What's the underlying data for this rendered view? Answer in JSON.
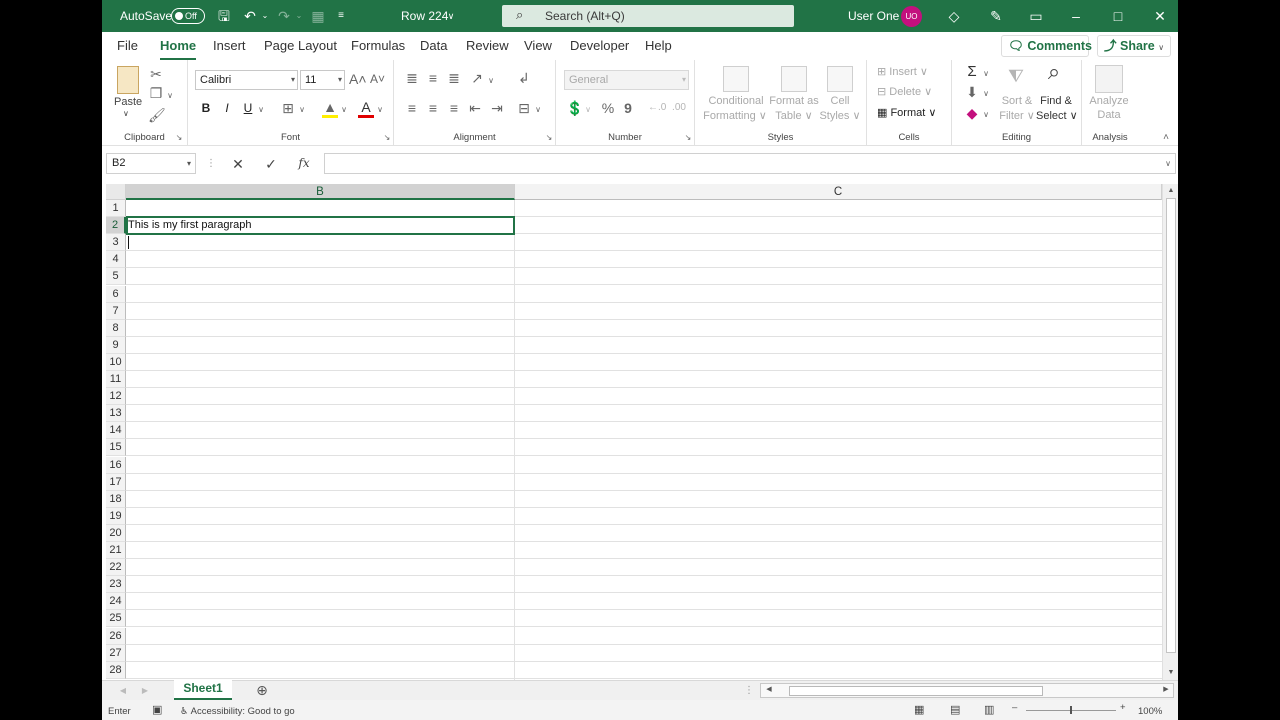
{
  "titlebar": {
    "autosave_label": "AutoSave",
    "autosave_state": "Off",
    "document_title": "Row 224",
    "search_placeholder": "Search (Alt+Q)",
    "user_name": "User One",
    "user_initials": "UO"
  },
  "tabs": [
    "File",
    "Home",
    "Insert",
    "Page Layout",
    "Formulas",
    "Data",
    "Review",
    "View",
    "Developer",
    "Help"
  ],
  "active_tab": "Home",
  "comments_label": "Comments",
  "share_label": "Share",
  "ribbon": {
    "clipboard": {
      "paste": "Paste",
      "label": "Clipboard"
    },
    "font": {
      "family": "Calibri",
      "size": "11",
      "bold": "B",
      "italic": "I",
      "underline": "U",
      "label": "Font"
    },
    "alignment": {
      "label": "Alignment"
    },
    "number": {
      "format": "General",
      "percent": "%",
      "comma": "9",
      "label": "Number"
    },
    "styles": {
      "conditional_1": "Conditional",
      "conditional_2": "Formatting",
      "format_table_1": "Format as",
      "format_table_2": "Table",
      "cell_styles_1": "Cell",
      "cell_styles_2": "Styles",
      "label": "Styles"
    },
    "cells": {
      "insert": "Insert",
      "delete": "Delete",
      "format": "Format",
      "label": "Cells"
    },
    "editing": {
      "sort_1": "Sort &",
      "sort_2": "Filter",
      "find_1": "Find &",
      "find_2": "Select",
      "label": "Editing"
    },
    "analysis": {
      "analyze_1": "Analyze",
      "analyze_2": "Data",
      "label": "Analysis"
    }
  },
  "formula_bar": {
    "name_box": "B2",
    "fx": "fx",
    "value": ""
  },
  "columns": [
    {
      "name": "B",
      "selected": true
    },
    {
      "name": "C",
      "selected": false
    }
  ],
  "rows": [
    "1",
    "2",
    "3",
    "4",
    "5",
    "6",
    "7",
    "8",
    "9",
    "10",
    "11",
    "12",
    "13",
    "14",
    "15",
    "16",
    "17",
    "18",
    "19",
    "20",
    "21",
    "22",
    "23",
    "24",
    "25",
    "26",
    "27",
    "28"
  ],
  "selected_row": "2",
  "cells": {
    "B2": "This is my first paragraph"
  },
  "sheets": [
    {
      "name": "Sheet1",
      "active": true
    }
  ],
  "status": {
    "mode": "Enter",
    "accessibility": "Accessibility: Good to go",
    "zoom": "100%"
  },
  "colors": {
    "accent": "#217346",
    "avatar": "#c3107e"
  }
}
